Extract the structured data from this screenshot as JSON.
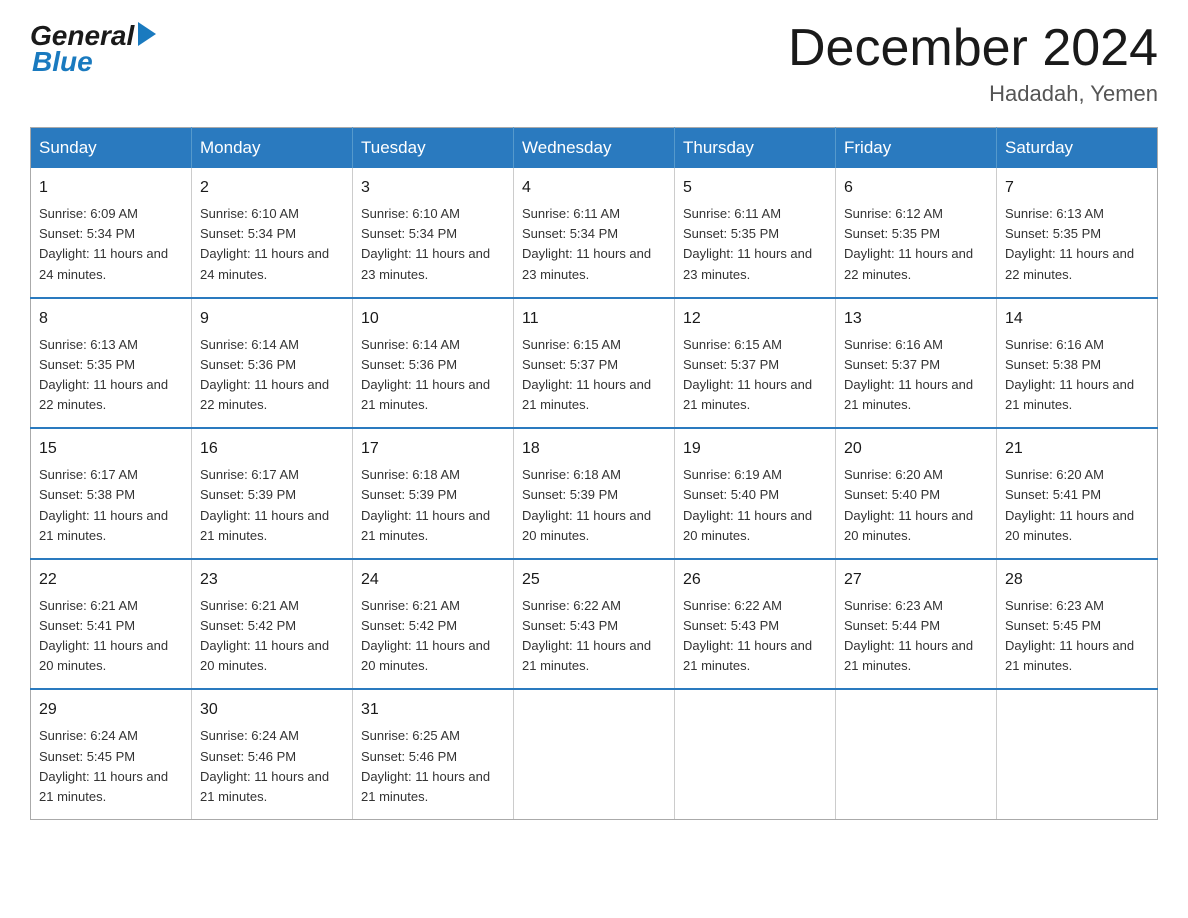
{
  "header": {
    "logo_general": "General",
    "logo_blue": "Blue",
    "main_title": "December 2024",
    "subtitle": "Hadadah, Yemen"
  },
  "calendar": {
    "days_of_week": [
      "Sunday",
      "Monday",
      "Tuesday",
      "Wednesday",
      "Thursday",
      "Friday",
      "Saturday"
    ],
    "weeks": [
      [
        {
          "day": "1",
          "sunrise": "6:09 AM",
          "sunset": "5:34 PM",
          "daylight": "11 hours and 24 minutes."
        },
        {
          "day": "2",
          "sunrise": "6:10 AM",
          "sunset": "5:34 PM",
          "daylight": "11 hours and 24 minutes."
        },
        {
          "day": "3",
          "sunrise": "6:10 AM",
          "sunset": "5:34 PM",
          "daylight": "11 hours and 23 minutes."
        },
        {
          "day": "4",
          "sunrise": "6:11 AM",
          "sunset": "5:34 PM",
          "daylight": "11 hours and 23 minutes."
        },
        {
          "day": "5",
          "sunrise": "6:11 AM",
          "sunset": "5:35 PM",
          "daylight": "11 hours and 23 minutes."
        },
        {
          "day": "6",
          "sunrise": "6:12 AM",
          "sunset": "5:35 PM",
          "daylight": "11 hours and 22 minutes."
        },
        {
          "day": "7",
          "sunrise": "6:13 AM",
          "sunset": "5:35 PM",
          "daylight": "11 hours and 22 minutes."
        }
      ],
      [
        {
          "day": "8",
          "sunrise": "6:13 AM",
          "sunset": "5:35 PM",
          "daylight": "11 hours and 22 minutes."
        },
        {
          "day": "9",
          "sunrise": "6:14 AM",
          "sunset": "5:36 PM",
          "daylight": "11 hours and 22 minutes."
        },
        {
          "day": "10",
          "sunrise": "6:14 AM",
          "sunset": "5:36 PM",
          "daylight": "11 hours and 21 minutes."
        },
        {
          "day": "11",
          "sunrise": "6:15 AM",
          "sunset": "5:37 PM",
          "daylight": "11 hours and 21 minutes."
        },
        {
          "day": "12",
          "sunrise": "6:15 AM",
          "sunset": "5:37 PM",
          "daylight": "11 hours and 21 minutes."
        },
        {
          "day": "13",
          "sunrise": "6:16 AM",
          "sunset": "5:37 PM",
          "daylight": "11 hours and 21 minutes."
        },
        {
          "day": "14",
          "sunrise": "6:16 AM",
          "sunset": "5:38 PM",
          "daylight": "11 hours and 21 minutes."
        }
      ],
      [
        {
          "day": "15",
          "sunrise": "6:17 AM",
          "sunset": "5:38 PM",
          "daylight": "11 hours and 21 minutes."
        },
        {
          "day": "16",
          "sunrise": "6:17 AM",
          "sunset": "5:39 PM",
          "daylight": "11 hours and 21 minutes."
        },
        {
          "day": "17",
          "sunrise": "6:18 AM",
          "sunset": "5:39 PM",
          "daylight": "11 hours and 21 minutes."
        },
        {
          "day": "18",
          "sunrise": "6:18 AM",
          "sunset": "5:39 PM",
          "daylight": "11 hours and 20 minutes."
        },
        {
          "day": "19",
          "sunrise": "6:19 AM",
          "sunset": "5:40 PM",
          "daylight": "11 hours and 20 minutes."
        },
        {
          "day": "20",
          "sunrise": "6:20 AM",
          "sunset": "5:40 PM",
          "daylight": "11 hours and 20 minutes."
        },
        {
          "day": "21",
          "sunrise": "6:20 AM",
          "sunset": "5:41 PM",
          "daylight": "11 hours and 20 minutes."
        }
      ],
      [
        {
          "day": "22",
          "sunrise": "6:21 AM",
          "sunset": "5:41 PM",
          "daylight": "11 hours and 20 minutes."
        },
        {
          "day": "23",
          "sunrise": "6:21 AM",
          "sunset": "5:42 PM",
          "daylight": "11 hours and 20 minutes."
        },
        {
          "day": "24",
          "sunrise": "6:21 AM",
          "sunset": "5:42 PM",
          "daylight": "11 hours and 20 minutes."
        },
        {
          "day": "25",
          "sunrise": "6:22 AM",
          "sunset": "5:43 PM",
          "daylight": "11 hours and 21 minutes."
        },
        {
          "day": "26",
          "sunrise": "6:22 AM",
          "sunset": "5:43 PM",
          "daylight": "11 hours and 21 minutes."
        },
        {
          "day": "27",
          "sunrise": "6:23 AM",
          "sunset": "5:44 PM",
          "daylight": "11 hours and 21 minutes."
        },
        {
          "day": "28",
          "sunrise": "6:23 AM",
          "sunset": "5:45 PM",
          "daylight": "11 hours and 21 minutes."
        }
      ],
      [
        {
          "day": "29",
          "sunrise": "6:24 AM",
          "sunset": "5:45 PM",
          "daylight": "11 hours and 21 minutes."
        },
        {
          "day": "30",
          "sunrise": "6:24 AM",
          "sunset": "5:46 PM",
          "daylight": "11 hours and 21 minutes."
        },
        {
          "day": "31",
          "sunrise": "6:25 AM",
          "sunset": "5:46 PM",
          "daylight": "11 hours and 21 minutes."
        },
        null,
        null,
        null,
        null
      ]
    ],
    "labels": {
      "sunrise_prefix": "Sunrise: ",
      "sunset_prefix": "Sunset: ",
      "daylight_prefix": "Daylight: "
    }
  }
}
